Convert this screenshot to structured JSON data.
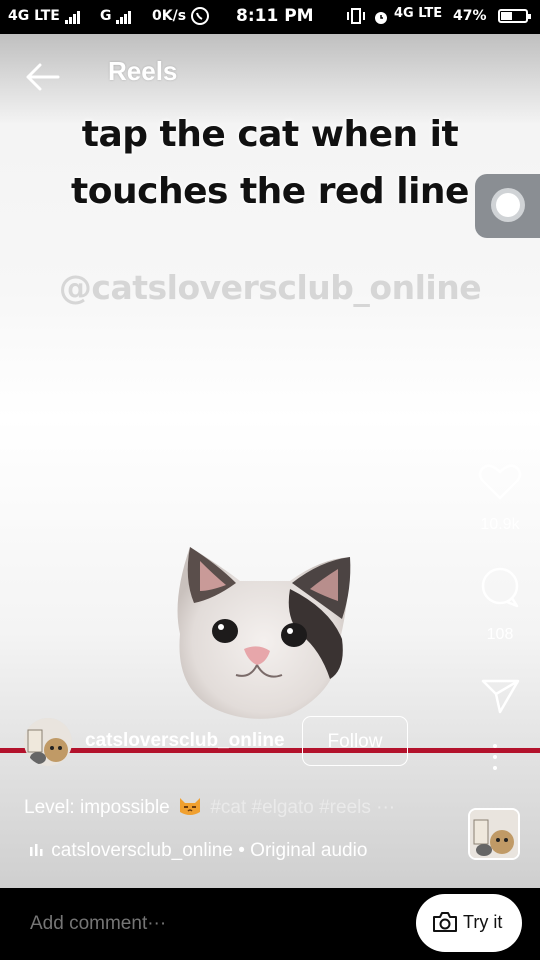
{
  "status_bar": {
    "network_left": "4G LTE",
    "network_second": "G",
    "data_speed": "0K/s",
    "time": "8:11 PM",
    "network_right": "4G LTE",
    "battery": "47%",
    "battery_level": 0.47
  },
  "header": {
    "title": "Reels"
  },
  "video": {
    "caption_line1": "tap the cat when it",
    "caption_line2": "touches the red line",
    "watermark": "@catsloversclub_online",
    "line_color": "#b3122c"
  },
  "actions": {
    "likes_count": "10.9k",
    "comments_count": "108"
  },
  "post": {
    "username": "catsloversclub_online",
    "follow_label": "Follow",
    "description_prefix": "Level: impossible",
    "hashtags": "#cat #elgato #reels ···",
    "audio_user": "catsloversclub_online",
    "audio_separator": "•",
    "audio_label": "Original audio"
  },
  "bottom": {
    "comment_placeholder": "Add comment···",
    "try_label": "Try it"
  },
  "icons": {
    "back": "back-arrow-icon",
    "like": "heart-icon",
    "comment": "comment-bubble-icon",
    "share": "send-icon",
    "more": "more-vertical-icon",
    "audio": "audio-bars-icon",
    "camera": "camera-icon",
    "whatsapp": "whatsapp-icon",
    "alarm": "alarm-icon",
    "vibrate": "vibrate-icon"
  }
}
